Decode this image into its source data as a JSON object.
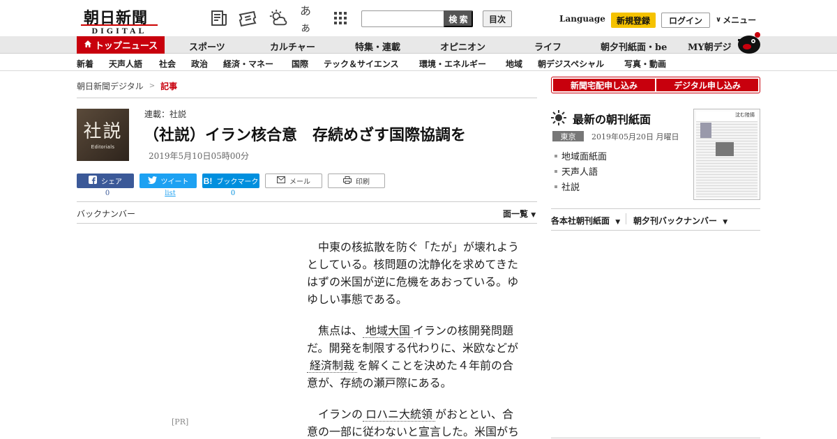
{
  "header": {
    "logo_main": "朝日新聞",
    "logo_sub": "DIGITAL",
    "font_size_icon_label": "あぁ",
    "search_placeholder": "",
    "search_button": "検 索",
    "toc_button": "目次",
    "language": "Language",
    "register": "新規登録",
    "login": "ログイン",
    "menu": "メニュー"
  },
  "nav1": {
    "top_news": "トップニュース",
    "items": [
      "スポーツ",
      "カルチャー",
      "特集・連載",
      "オピニオン",
      "ライフ",
      "朝夕刊紙面・be",
      "MY朝デジ"
    ]
  },
  "nav2": {
    "items": [
      "新着",
      "天声人語",
      "社会",
      "政治",
      "経済・マネー",
      "国際",
      "テック＆サイエンス",
      "環境・エネルギー",
      "地域",
      "朝デジスペシャル",
      "写真・動画"
    ]
  },
  "breadcrumb": {
    "home": "朝日新聞デジタル",
    "sep": ">",
    "current": "記事"
  },
  "article": {
    "thumb_ja": "社説",
    "thumb_en": "Editorials",
    "series": "連載：社説",
    "title": "（社説）イラン核合意　存続めざす国際協調を",
    "date": "2019年5月10日05時00分"
  },
  "share": {
    "facebook": "シェア",
    "twitter": "ツイート",
    "hatena": "ブックマーク",
    "mail": "メール",
    "print": "印刷",
    "facebook_count": "0",
    "twitter_count": "list",
    "hatena_count": "0"
  },
  "backnumber": "バックナンバー",
  "face_list": "面一覧",
  "body": {
    "p1": "中東の核拡散を防ぐ「たが」が壊れようとしている。核問題の沈静化を求めてきたはずの米国が逆に危機をあおっている。ゆゆしい事態である。",
    "p2_a": "焦点は、",
    "p2_kw1": "地域大国",
    "p2_b": "イランの核開発問題だ。開発を制限する代わりに、米欧などが",
    "p2_kw2": "経済制裁",
    "p2_c": "を解くことを決めた４年前の合意が、存続の瀬戸際にある。",
    "p3_a": "イランの",
    "p3_kw1": "ロハニ大統領",
    "p3_b": "がおととい、合意の一部に従わないと宣言した。米国がち"
  },
  "pr": "[PR]",
  "right": {
    "sub_home": "新聞宅配申し込み",
    "sub_digital": "デジタル申し込み",
    "latest_title": "最新の朝刊紙面",
    "region": "東京",
    "latest_date": "2019年05月20日 月曜日",
    "items": [
      "地域面紙面",
      "天声人語",
      "社説"
    ],
    "paper_head": "沈む陸揚",
    "sub_links": [
      "各本社朝刊紙面",
      "朝夕刊バックナンバー"
    ]
  },
  "colors": {
    "brand_red": "#c8000d",
    "register_yellow": "#f5c200",
    "facebook": "#3b5998",
    "twitter": "#1da1f2",
    "hatena": "#008fde"
  }
}
